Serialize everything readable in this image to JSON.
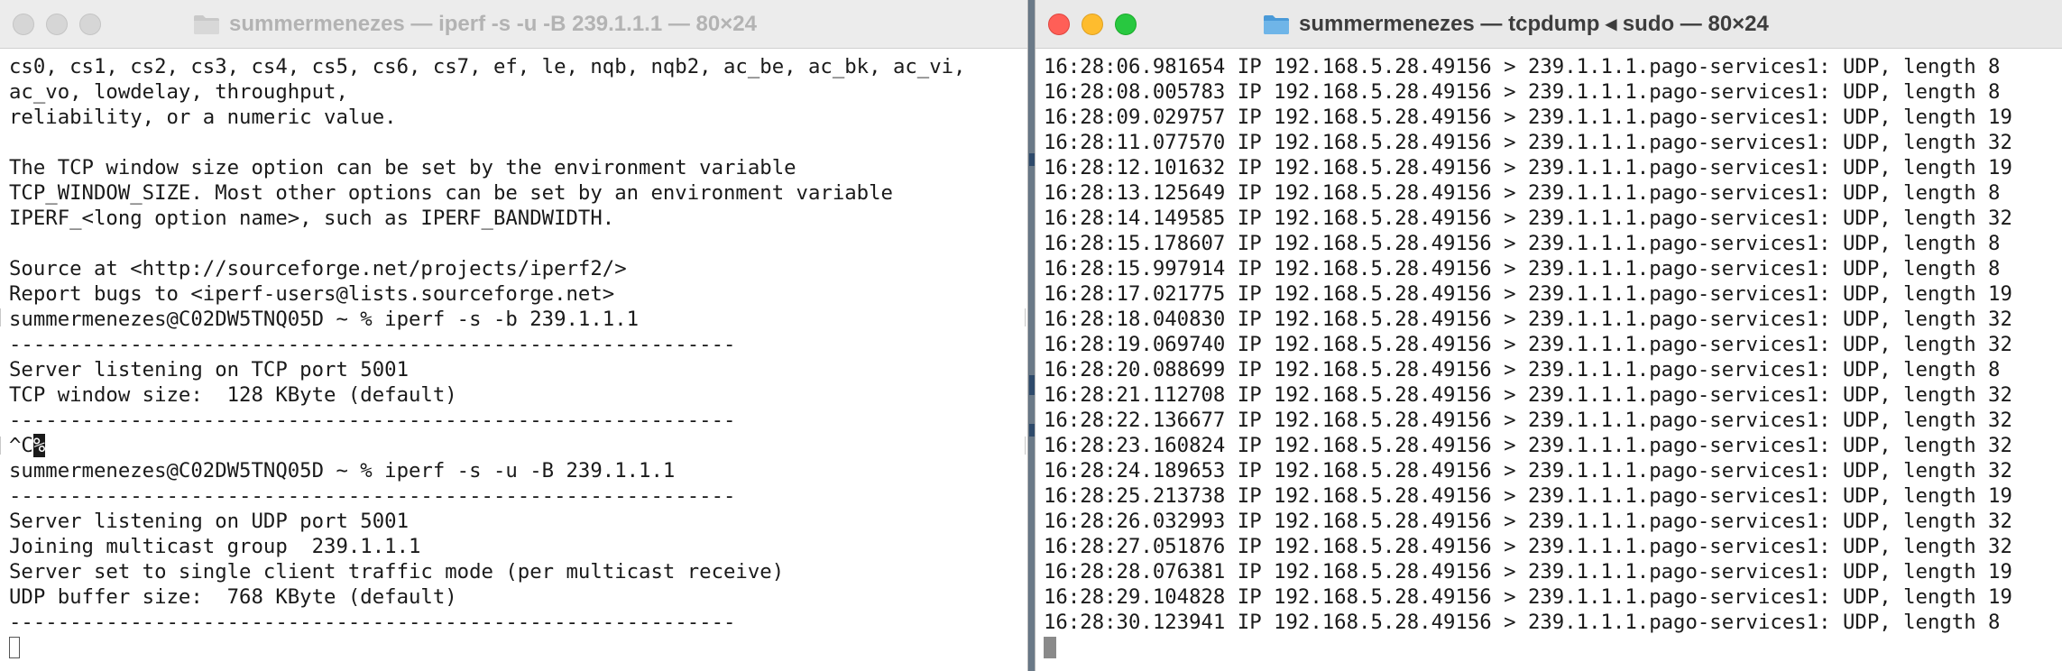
{
  "left_window": {
    "title": "summermenezes — iperf -s -u -B 239.1.1.1 — 80×24",
    "lines": [
      "cs0, cs1, cs2, cs3, cs4, cs5, cs6, cs7, ef, le, nqb, nqb2, ac_be, ac_bk, ac_vi,",
      "ac_vo, lowdelay, throughput,",
      "reliability, or a numeric value.",
      "",
      "The TCP window size option can be set by the environment variable",
      "TCP_WINDOW_SIZE. Most other options can be set by an environment variable",
      "IPERF_<long option name>, such as IPERF_BANDWIDTH.",
      "",
      "Source at <http://sourceforge.net/projects/iperf2/>",
      "Report bugs to <iperf-users@lists.sourceforge.net>",
      "summermenezes@C02DW5TNQ05D ~ % iperf -s -b 239.1.1.1",
      "------------------------------------------------------------",
      "Server listening on TCP port 5001",
      "TCP window size:  128 KByte (default)",
      "------------------------------------------------------------",
      "^C",
      "summermenezes@C02DW5TNQ05D ~ % iperf -s -u -B 239.1.1.1",
      "------------------------------------------------------------",
      "Server listening on UDP port 5001",
      "Joining multicast group  239.1.1.1",
      "Server set to single client traffic mode (per multicast receive)",
      "UDP buffer size:  768 KByte (default)",
      "------------------------------------------------------------"
    ],
    "interrupt_suffix": "%"
  },
  "right_window": {
    "title": "summermenezes — tcpdump ◂ sudo — 80×24",
    "lines": [
      "16:28:06.981654 IP 192.168.5.28.49156 > 239.1.1.1.pago-services1: UDP, length 8",
      "16:28:08.005783 IP 192.168.5.28.49156 > 239.1.1.1.pago-services1: UDP, length 8",
      "16:28:09.029757 IP 192.168.5.28.49156 > 239.1.1.1.pago-services1: UDP, length 19",
      "16:28:11.077570 IP 192.168.5.28.49156 > 239.1.1.1.pago-services1: UDP, length 32",
      "16:28:12.101632 IP 192.168.5.28.49156 > 239.1.1.1.pago-services1: UDP, length 19",
      "16:28:13.125649 IP 192.168.5.28.49156 > 239.1.1.1.pago-services1: UDP, length 8",
      "16:28:14.149585 IP 192.168.5.28.49156 > 239.1.1.1.pago-services1: UDP, length 32",
      "16:28:15.178607 IP 192.168.5.28.49156 > 239.1.1.1.pago-services1: UDP, length 8",
      "16:28:15.997914 IP 192.168.5.28.49156 > 239.1.1.1.pago-services1: UDP, length 8",
      "16:28:17.021775 IP 192.168.5.28.49156 > 239.1.1.1.pago-services1: UDP, length 19",
      "16:28:18.040830 IP 192.168.5.28.49156 > 239.1.1.1.pago-services1: UDP, length 32",
      "16:28:19.069740 IP 192.168.5.28.49156 > 239.1.1.1.pago-services1: UDP, length 32",
      "16:28:20.088699 IP 192.168.5.28.49156 > 239.1.1.1.pago-services1: UDP, length 8",
      "16:28:21.112708 IP 192.168.5.28.49156 > 239.1.1.1.pago-services1: UDP, length 32",
      "16:28:22.136677 IP 192.168.5.28.49156 > 239.1.1.1.pago-services1: UDP, length 32",
      "16:28:23.160824 IP 192.168.5.28.49156 > 239.1.1.1.pago-services1: UDP, length 32",
      "16:28:24.189653 IP 192.168.5.28.49156 > 239.1.1.1.pago-services1: UDP, length 32",
      "16:28:25.213738 IP 192.168.5.28.49156 > 239.1.1.1.pago-services1: UDP, length 19",
      "16:28:26.032993 IP 192.168.5.28.49156 > 239.1.1.1.pago-services1: UDP, length 32",
      "16:28:27.051876 IP 192.168.5.28.49156 > 239.1.1.1.pago-services1: UDP, length 32",
      "16:28:28.076381 IP 192.168.5.28.49156 > 239.1.1.1.pago-services1: UDP, length 19",
      "16:28:29.104828 IP 192.168.5.28.49156 > 239.1.1.1.pago-services1: UDP, length 19",
      "16:28:30.123941 IP 192.168.5.28.49156 > 239.1.1.1.pago-services1: UDP, length 8"
    ]
  },
  "colors": {
    "close": "#ff5f57",
    "minimize": "#febc2e",
    "zoom": "#28c840",
    "folder": "#6fb5e8"
  }
}
